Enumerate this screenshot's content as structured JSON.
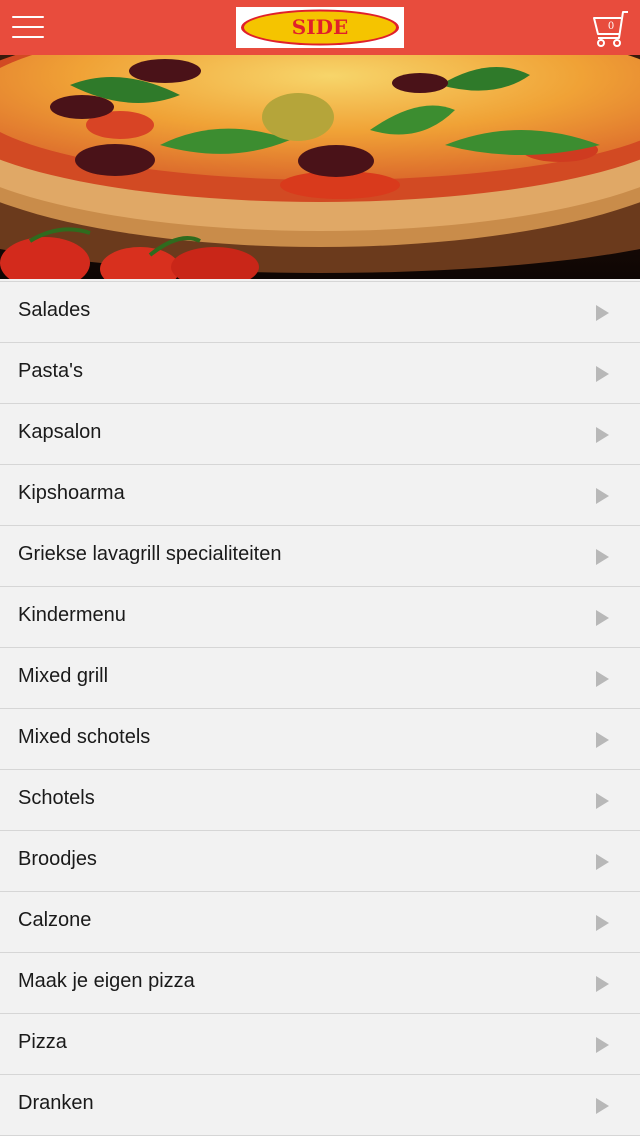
{
  "header": {
    "logo_text": "SIDE",
    "cart_count": "0",
    "colors": {
      "bar": "#e84c3d",
      "logo_oval": "#f5c400",
      "logo_text": "#e0202a"
    }
  },
  "menu": {
    "items": [
      {
        "label": "Salades"
      },
      {
        "label": "Pasta's"
      },
      {
        "label": "Kapsalon"
      },
      {
        "label": "Kipshoarma"
      },
      {
        "label": "Griekse lavagrill specialiteiten"
      },
      {
        "label": "Kindermenu"
      },
      {
        "label": "Mixed grill"
      },
      {
        "label": "Mixed schotels"
      },
      {
        "label": "Schotels"
      },
      {
        "label": "Broodjes"
      },
      {
        "label": "Calzone"
      },
      {
        "label": "Maak je eigen pizza"
      },
      {
        "label": "Pizza"
      },
      {
        "label": "Dranken"
      }
    ]
  }
}
